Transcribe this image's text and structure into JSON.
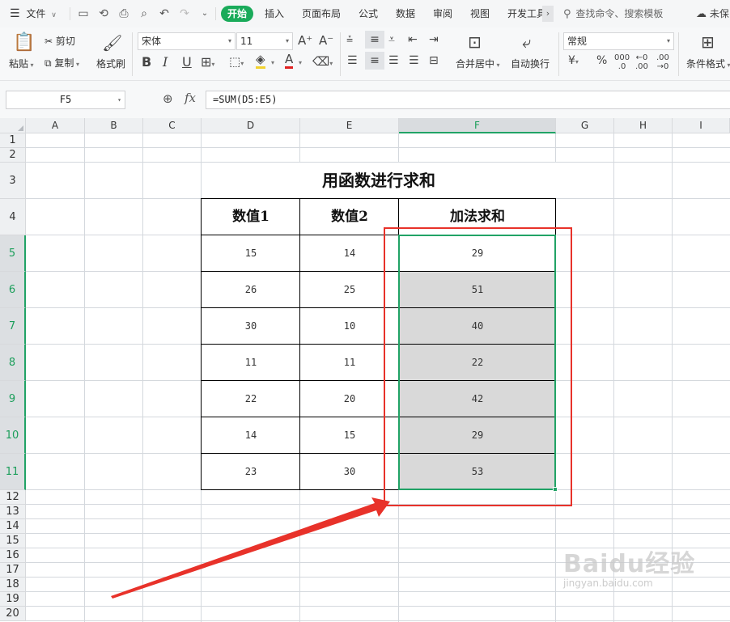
{
  "menubar": {
    "file_label": "文件",
    "tabs": [
      {
        "label": "开始",
        "active": true
      },
      {
        "label": "插入"
      },
      {
        "label": "页面布局"
      },
      {
        "label": "公式"
      },
      {
        "label": "数据"
      },
      {
        "label": "审阅"
      },
      {
        "label": "视图"
      },
      {
        "label": "开发工具"
      }
    ],
    "search_placeholder": "查找命令、搜索模板",
    "unsaved_label": "未保",
    "accent_color": "#1aab5a"
  },
  "ribbon": {
    "paste_label": "粘贴",
    "cut_label": "剪切",
    "copy_label": "复制",
    "format_painter_label": "格式刷",
    "font_name": "宋体",
    "font_size": "11",
    "merge_center_label": "合并居中",
    "wrap_text_label": "自动换行",
    "number_format": "常规",
    "conditional_format_label": "条件格式"
  },
  "formula_bar": {
    "name_box": "F5",
    "fx_label": "fx",
    "formula": "=SUM(D5:E5)"
  },
  "grid": {
    "columns": [
      "A",
      "B",
      "C",
      "D",
      "E",
      "F",
      "G",
      "H",
      "I"
    ],
    "rows": [
      "1",
      "2",
      "3",
      "4",
      "5",
      "6",
      "7",
      "8",
      "9",
      "10",
      "11",
      "12",
      "13",
      "14",
      "15",
      "16",
      "17",
      "18",
      "19",
      "20"
    ],
    "selected_column": "F",
    "selected_rows": [
      "5",
      "6",
      "7",
      "8",
      "9",
      "10",
      "11"
    ],
    "selection_color": "#21a366",
    "annotation_color": "#e8322a"
  },
  "sheet": {
    "title": "用函数进行求和",
    "headers": [
      "数值1",
      "数值2",
      "加法求和"
    ],
    "rows": [
      [
        "15",
        "14",
        "29"
      ],
      [
        "26",
        "25",
        "51"
      ],
      [
        "30",
        "10",
        "40"
      ],
      [
        "11",
        "11",
        "22"
      ],
      [
        "22",
        "20",
        "42"
      ],
      [
        "14",
        "15",
        "29"
      ],
      [
        "23",
        "30",
        "53"
      ]
    ]
  },
  "watermark": {
    "brand": "Baidu经验",
    "url": "jingyan.baidu.com"
  }
}
